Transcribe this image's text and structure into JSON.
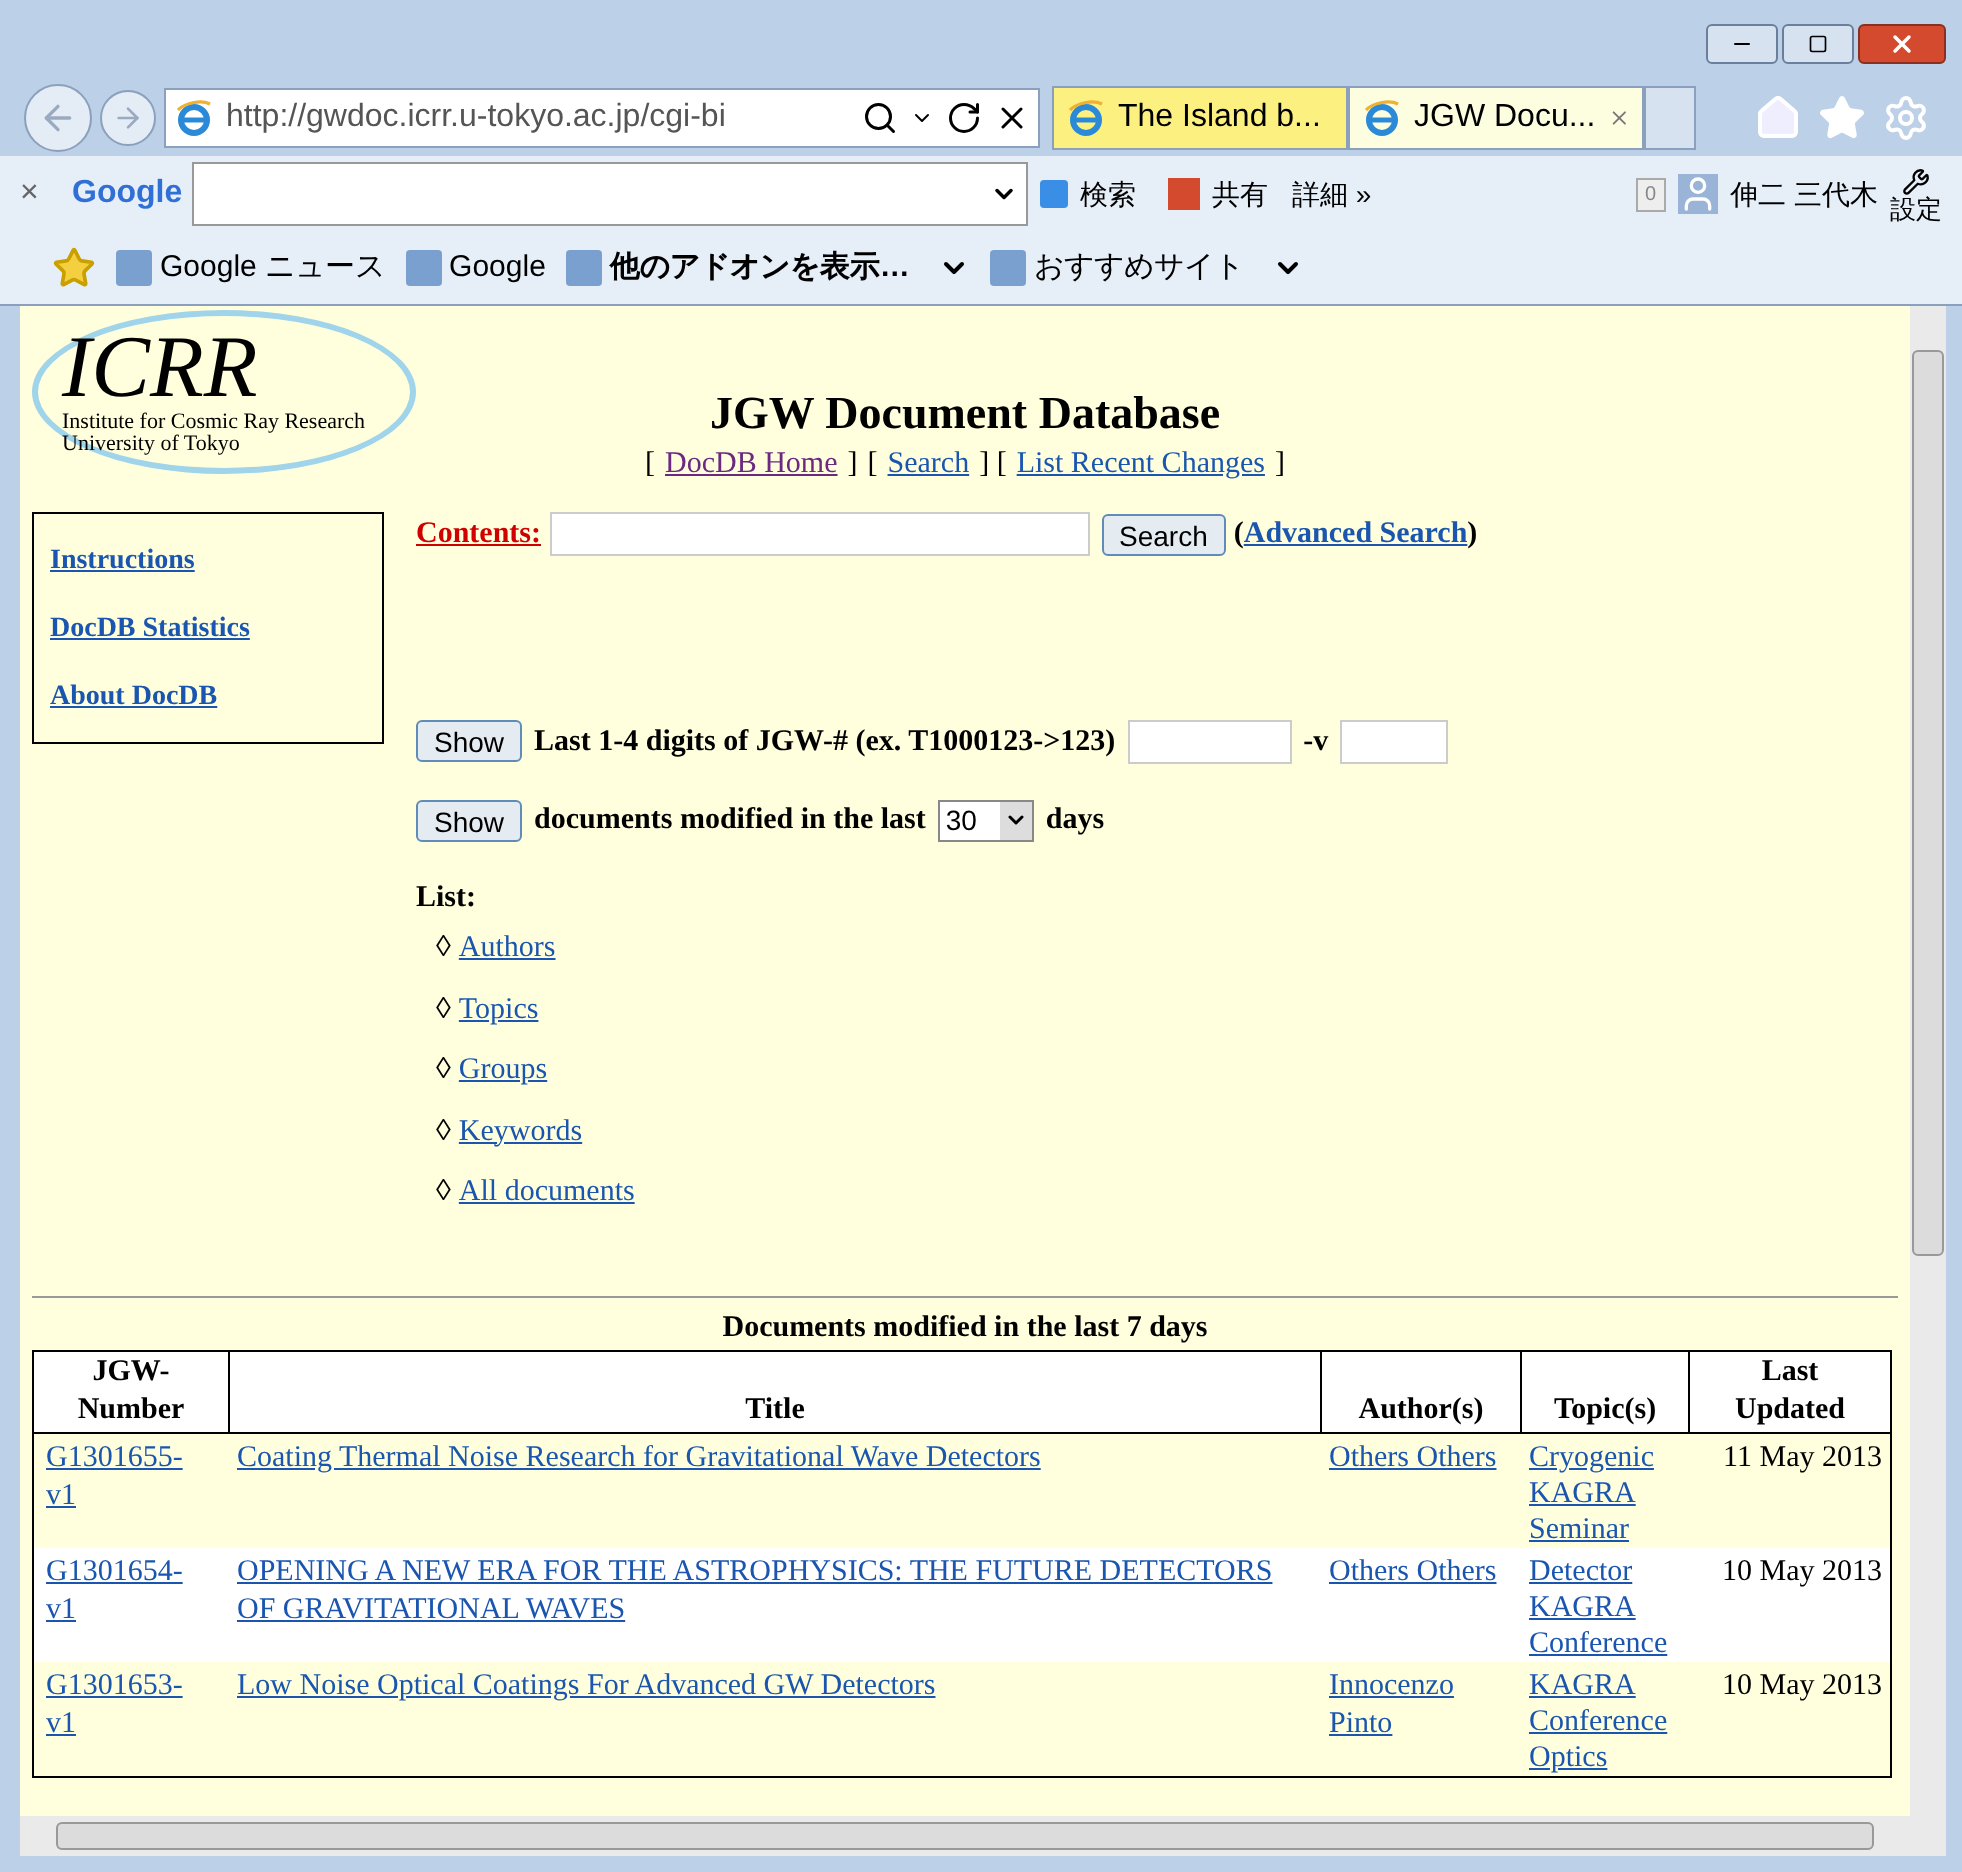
{
  "address_bar": {
    "url": "http://gwdoc.icrr.u-tokyo.ac.jp/cgi-bi"
  },
  "tabs": [
    {
      "label": "The Island b...",
      "selected": false
    },
    {
      "label": "JGW Docu...",
      "selected": true
    }
  ],
  "google_toolbar": {
    "close": "×",
    "brand": "Google",
    "search_button": "検索",
    "share": "共有",
    "more": "詳細 »",
    "count": "0",
    "user": "伸二 三代木",
    "settings": "設定"
  },
  "favorites_bar": [
    {
      "label": "Google ニュース",
      "bold": false,
      "menu": false
    },
    {
      "label": "Google",
      "bold": false,
      "menu": false
    },
    {
      "label": "他のアドオンを表示…",
      "bold": true,
      "menu": true
    },
    {
      "label": "おすすめサイト",
      "bold": false,
      "menu": true
    }
  ],
  "logo": {
    "mark": "ICRR",
    "line1": "Institute for Cosmic Ray Research",
    "line2": "University of Tokyo"
  },
  "heading": "JGW Document Database",
  "nav": [
    {
      "kind": "text",
      "text": "["
    },
    {
      "kind": "link",
      "text": "DocDB Home",
      "visited": true
    },
    {
      "kind": "text",
      "text": "]"
    },
    {
      "kind": "text",
      "text": "["
    },
    {
      "kind": "link",
      "text": "Search",
      "visited": false
    },
    {
      "kind": "text",
      "text": "] ["
    },
    {
      "kind": "link",
      "text": "List Recent Changes",
      "visited": false
    },
    {
      "kind": "text",
      "text": "]"
    }
  ],
  "sidebar": {
    "items": [
      "Instructions",
      "DocDB Statistics",
      "About DocDB"
    ]
  },
  "contents_search": {
    "label": "Contents:",
    "button": "Search",
    "open": "(",
    "advanced": "Advanced Search",
    "close": ")"
  },
  "jgw_form": {
    "button": "Show",
    "label": "Last 1-4 digits of JGW-# (ex. T1000123->123)",
    "version_label": "-v"
  },
  "modified_form": {
    "button": "Show",
    "label": "documents modified in the last",
    "value": "30",
    "suffix": "days"
  },
  "list": {
    "heading": "List:",
    "items": [
      {
        "bullet": "◊",
        "label": "Authors"
      },
      {
        "bullet": "◊",
        "label": "Topics"
      },
      {
        "bullet": "◊",
        "label": "Groups"
      },
      {
        "bullet": "◊",
        "label": "Keywords"
      },
      {
        "bullet": "◊",
        "label": "All documents"
      }
    ]
  },
  "table": {
    "caption": "Documents modified in the last 7 days",
    "columns": [
      "JGW-\nNumber",
      "Title",
      "Author(s)",
      "Topic(s)",
      "Last\nUpdated"
    ],
    "rows": [
      {
        "number": "G1301655-\nv1",
        "title": "Coating Thermal Noise Research for Gravitational Wave Detectors",
        "authors": [
          "Others Others"
        ],
        "topics": [
          "Cryogenic",
          "KAGRA",
          "Seminar"
        ],
        "updated": "11 May 2013"
      },
      {
        "number": "G1301654-\nv1",
        "title": "OPENING A NEW ERA FOR THE ASTROPHYSICS: THE FUTURE DETECTORS OF GRAVITATIONAL WAVES",
        "authors": [
          "Others Others"
        ],
        "topics": [
          "Detector",
          "KAGRA",
          "Conference"
        ],
        "updated": "10 May 2013"
      },
      {
        "number": "G1301653-\nv1",
        "title": "Low Noise Optical Coatings For Advanced GW Detectors",
        "authors": [
          "Innocenzo\nPinto"
        ],
        "topics": [
          "KAGRA",
          "Conference",
          "Optics"
        ],
        "updated": "10 May 2013"
      }
    ]
  }
}
